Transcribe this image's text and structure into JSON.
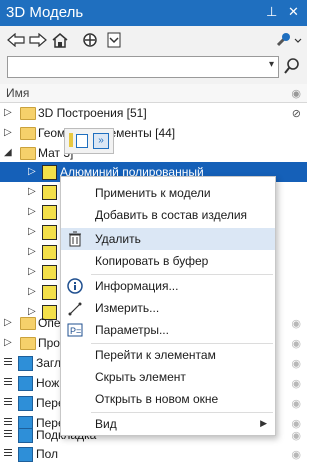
{
  "title": "3D Модель",
  "column_header": "Имя",
  "tree": {
    "rows": [
      {
        "label": "3D Построения [51]"
      },
      {
        "label": "Геом        ские элементы [44]"
      },
      {
        "label": "Мат            3]"
      },
      {
        "label": "Алюминий полированный"
      },
      {
        "label": "Опе"
      },
      {
        "label": "Про"
      },
      {
        "label": "Загл"
      },
      {
        "label": "Нож"
      },
      {
        "label": "Пере"
      },
      {
        "label": "Пере"
      },
      {
        "label": "Подкладка"
      },
      {
        "label": "Пол"
      }
    ]
  },
  "context_menu": {
    "items": [
      {
        "label": "Применить к модели"
      },
      {
        "label": "Добавить в состав изделия"
      },
      {
        "label": "Удалить"
      },
      {
        "label": "Копировать в буфер"
      },
      {
        "label": "Информация..."
      },
      {
        "label": "Измерить..."
      },
      {
        "label": "Параметры..."
      },
      {
        "label": "Перейти к элементам"
      },
      {
        "label": "Скрыть элемент"
      },
      {
        "label": "Открыть в новом окне"
      },
      {
        "label": "Вид"
      }
    ]
  },
  "colors": {
    "title_bar": "#1f6fbf",
    "selection": "#1560b8",
    "highlight": "#dbe7f5"
  }
}
